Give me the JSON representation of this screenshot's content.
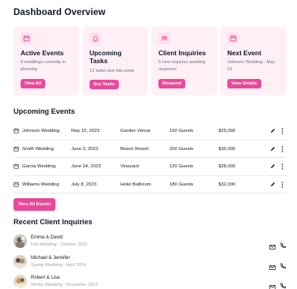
{
  "page": {
    "title": "Dashboard Overview"
  },
  "colors": {
    "accent": "#ec4899",
    "card_bg": "#fff0f6",
    "icon_bg": "#fde1ee"
  },
  "cards": [
    {
      "icon": "calendar-icon",
      "title": "Active Events",
      "desc": "8 weddings currently in planning",
      "button": "View All"
    },
    {
      "icon": "bell-icon",
      "title": "Upcoming Tasks",
      "desc": "12 tasks due this week",
      "button": "See Tasks"
    },
    {
      "icon": "users-icon",
      "title": "Client Inquiries",
      "desc": "5 new inquiries awaiting response",
      "button": "Respond"
    },
    {
      "icon": "calendar-icon",
      "title": "Next Event",
      "desc": "Johnson Wedding - May 15",
      "button": "View Details"
    }
  ],
  "events": {
    "title": "Upcoming Events",
    "rows": [
      {
        "name": "Johnson Wedding",
        "date": "May 15, 2023",
        "venue": "Garden Venue",
        "guests": "150 Guests",
        "amount": "$25,000"
      },
      {
        "name": "Smith Wedding",
        "date": "June 3, 2023",
        "venue": "Beach Resort",
        "guests": "200 Guests",
        "amount": "$35,000"
      },
      {
        "name": "Garcia Wedding",
        "date": "June 24, 2023",
        "venue": "Vineyard",
        "guests": "120 Guests",
        "amount": "$28,000"
      },
      {
        "name": "Williams Wedding",
        "date": "July 8, 2023",
        "venue": "Hotel Ballroom",
        "guests": "180 Guests",
        "amount": "$32,000"
      }
    ],
    "view_all": "View All Events"
  },
  "inquiries": {
    "title": "Recent Client Inquiries",
    "rows": [
      {
        "name": "Emma & David",
        "sub": "Fall Wedding - October 2023"
      },
      {
        "name": "Michael & Jennifer",
        "sub": "Spring Wedding - April 2024"
      },
      {
        "name": "Robert & Lisa",
        "sub": "Winter Wedding - December 2023"
      }
    ]
  }
}
